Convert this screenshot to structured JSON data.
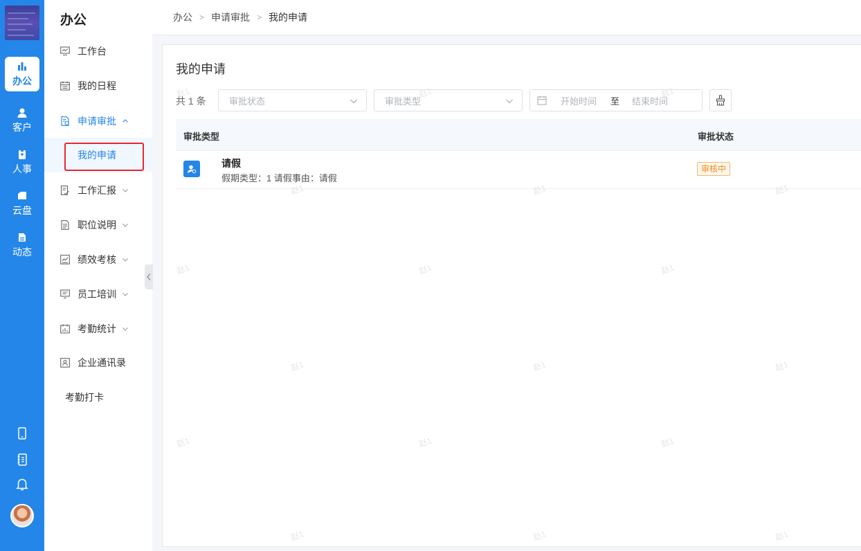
{
  "rail": {
    "items": [
      {
        "label": "办公",
        "icon": "office-icon",
        "active": true
      },
      {
        "label": "客户",
        "icon": "customer-icon"
      },
      {
        "label": "人事",
        "icon": "hr-icon"
      },
      {
        "label": "云盘",
        "icon": "cloud-disk-icon"
      },
      {
        "label": "动态",
        "icon": "feed-icon"
      }
    ],
    "bottom_icons": [
      "phone-icon",
      "notebook-icon",
      "bell-icon"
    ]
  },
  "sidebar": {
    "title": "办公",
    "items": [
      {
        "label": "工作台",
        "icon": "dashboard-icon"
      },
      {
        "label": "我的日程",
        "icon": "calendar-icon"
      },
      {
        "label": "申请审批",
        "icon": "approval-icon",
        "expanded": true
      },
      {
        "label": "工作汇报",
        "icon": "report-icon"
      },
      {
        "label": "职位说明",
        "icon": "document-icon"
      },
      {
        "label": "绩效考核",
        "icon": "performance-icon"
      },
      {
        "label": "员工培训",
        "icon": "training-icon"
      },
      {
        "label": "考勤统计",
        "icon": "attendance-icon"
      },
      {
        "label": "企业通讯录",
        "icon": "contacts-icon"
      },
      {
        "label": "考勤打卡"
      }
    ],
    "sub_item": "我的申请"
  },
  "breadcrumb": [
    "办公",
    "申请审批",
    "我的申请"
  ],
  "panel": {
    "title": "我的申请",
    "count": "共 1 条",
    "filters": {
      "status_placeholder": "审批状态",
      "type_placeholder": "审批类型",
      "start_placeholder": "开始时间",
      "range_sep": "至",
      "end_placeholder": "结束时间"
    },
    "columns": [
      "审批类型",
      "审批状态"
    ],
    "rows": [
      {
        "title": "请假",
        "desc": "假期类型：1 请假事由：请假",
        "status": "审核中"
      }
    ]
  },
  "watermark": "赵1",
  "colors": {
    "primary": "#2486e8",
    "status_pending": "#f08c1a",
    "highlight": "#e8272b"
  }
}
